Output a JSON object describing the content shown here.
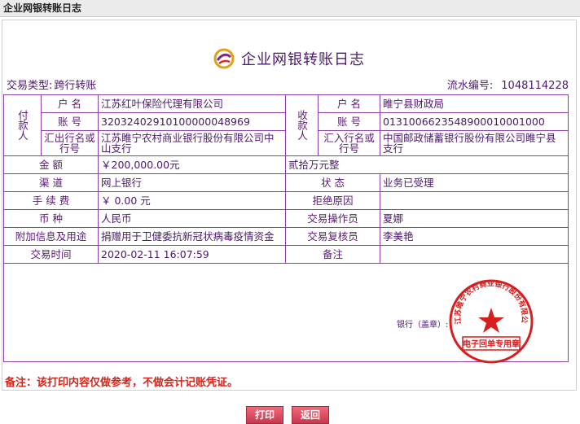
{
  "window": {
    "title": "企业网银转账日志"
  },
  "heading": {
    "title": "企业网银转账日志"
  },
  "meta": {
    "type_label": "交易类型:",
    "type_value": "跨行转账",
    "serial_label": "流水编号:",
    "serial_value": "1048114228"
  },
  "payer": {
    "group_label": "付款人",
    "name_label": "户  名",
    "name": "江苏红叶保险代理有限公司",
    "account_label": "账  号",
    "account": "32032402910100000048969",
    "bank_label": "汇出行名或行号",
    "bank": "江苏睢宁农村商业银行股份有限公司中山支行"
  },
  "payee": {
    "group_label": "收款人",
    "name_label": "户  名",
    "name": "睢宁县财政局",
    "account_label": "账  号",
    "account": "0131006623548900010001000",
    "bank_label": "汇入行名或行号",
    "bank": "中国邮政储蓄银行股份有限公司睢宁县支行"
  },
  "rows": {
    "amount_label": "金    额",
    "amount": "￥200,000.00元",
    "amount_words": "贰拾万元整",
    "channel_label": "渠    道",
    "channel": "网上银行",
    "status_label": "状    态",
    "status": "业务已受理",
    "fee_label": "手 续 费",
    "fee": "￥ 0.00 元",
    "reject_label": "拒绝原因",
    "reject": "",
    "currency_label": "币    种",
    "currency": "人民币",
    "operator_label": "交易操作员",
    "operator": "夏娜",
    "purpose_label": "附加信息及用途",
    "purpose": "捐赠用于卫健委抗新冠状病毒疫情资金",
    "reviewer_label": "交易复核员",
    "reviewer": "李美艳",
    "time_label": "交易时间",
    "time": "2020-02-11 16:07:59",
    "remark_label": "备注",
    "remark": ""
  },
  "signature": {
    "bank_seal_label": "银行（盖章）:",
    "stamp_text": "江苏睢宁农村商业银行股份有限公司",
    "stamp_bottom": "电子回单专用章"
  },
  "note": "备注：该打印内容仅做参考，不做会计记账凭证。",
  "buttons": {
    "print": "打印",
    "back": "返回"
  },
  "colors": {
    "border": "#8a3fa8",
    "text": "#5a1a75",
    "stamp": "#d81e1e",
    "button": "#d8485a"
  }
}
